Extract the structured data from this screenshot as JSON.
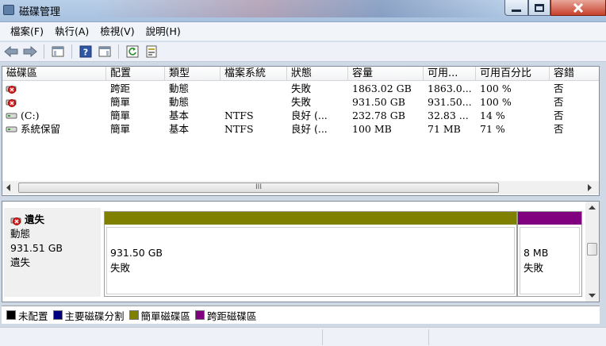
{
  "window": {
    "title": "磁碟管理"
  },
  "menu": [
    {
      "label": "檔案(F)"
    },
    {
      "label": "執行(A)"
    },
    {
      "label": "檢視(V)"
    },
    {
      "label": "說明(H)"
    }
  ],
  "toolbar": {
    "icons": [
      "back-arrow-icon",
      "forward-arrow-icon",
      "console-tree-icon",
      "help-icon",
      "action-pane-icon",
      "refresh-icon",
      "properties-icon"
    ]
  },
  "volume_list": {
    "columns": [
      "磁碟區",
      "配置",
      "類型",
      "檔案系統",
      "狀態",
      "容量",
      "可用...",
      "可用百分比",
      "容錯"
    ],
    "rows": [
      {
        "icon": "failed-disk-icon",
        "volume": "",
        "layout": "跨距",
        "type": "動態",
        "fs": "",
        "status": "失敗",
        "capacity": "1863.02 GB",
        "free": "1863.0...",
        "pct": "100 %",
        "fault": "否"
      },
      {
        "icon": "failed-disk-icon",
        "volume": "",
        "layout": "簡單",
        "type": "動態",
        "fs": "",
        "status": "失敗",
        "capacity": "931.50 GB",
        "free": "931.50...",
        "pct": "100 %",
        "fault": "否"
      },
      {
        "icon": "disk-drive-icon",
        "volume": "(C:)",
        "layout": "簡單",
        "type": "基本",
        "fs": "NTFS",
        "status": "良好 (...",
        "capacity": "232.78 GB",
        "free": "32.83 ...",
        "pct": "14 %",
        "fault": "否"
      },
      {
        "icon": "disk-drive-icon",
        "volume": "系統保留",
        "layout": "簡單",
        "type": "基本",
        "fs": "NTFS",
        "status": "良好 (...",
        "capacity": "100 MB",
        "free": "71 MB",
        "pct": "71 %",
        "fault": "否"
      }
    ],
    "hscroll_grip": "III"
  },
  "disk_view": {
    "name": "遺失",
    "type": "動態",
    "size": "931.51 GB",
    "state": "遺失",
    "partitions": [
      {
        "size": "931.50 GB",
        "status": "失敗",
        "color": "#808000"
      },
      {
        "size": "8 MB",
        "status": "失敗",
        "color": "#800080"
      }
    ]
  },
  "legend": [
    {
      "label": "未配置",
      "color": "#000000"
    },
    {
      "label": "主要磁碟分割",
      "color": "#000080"
    },
    {
      "label": "簡單磁碟區",
      "color": "#808000"
    },
    {
      "label": "跨距磁碟區",
      "color": "#800080"
    }
  ]
}
